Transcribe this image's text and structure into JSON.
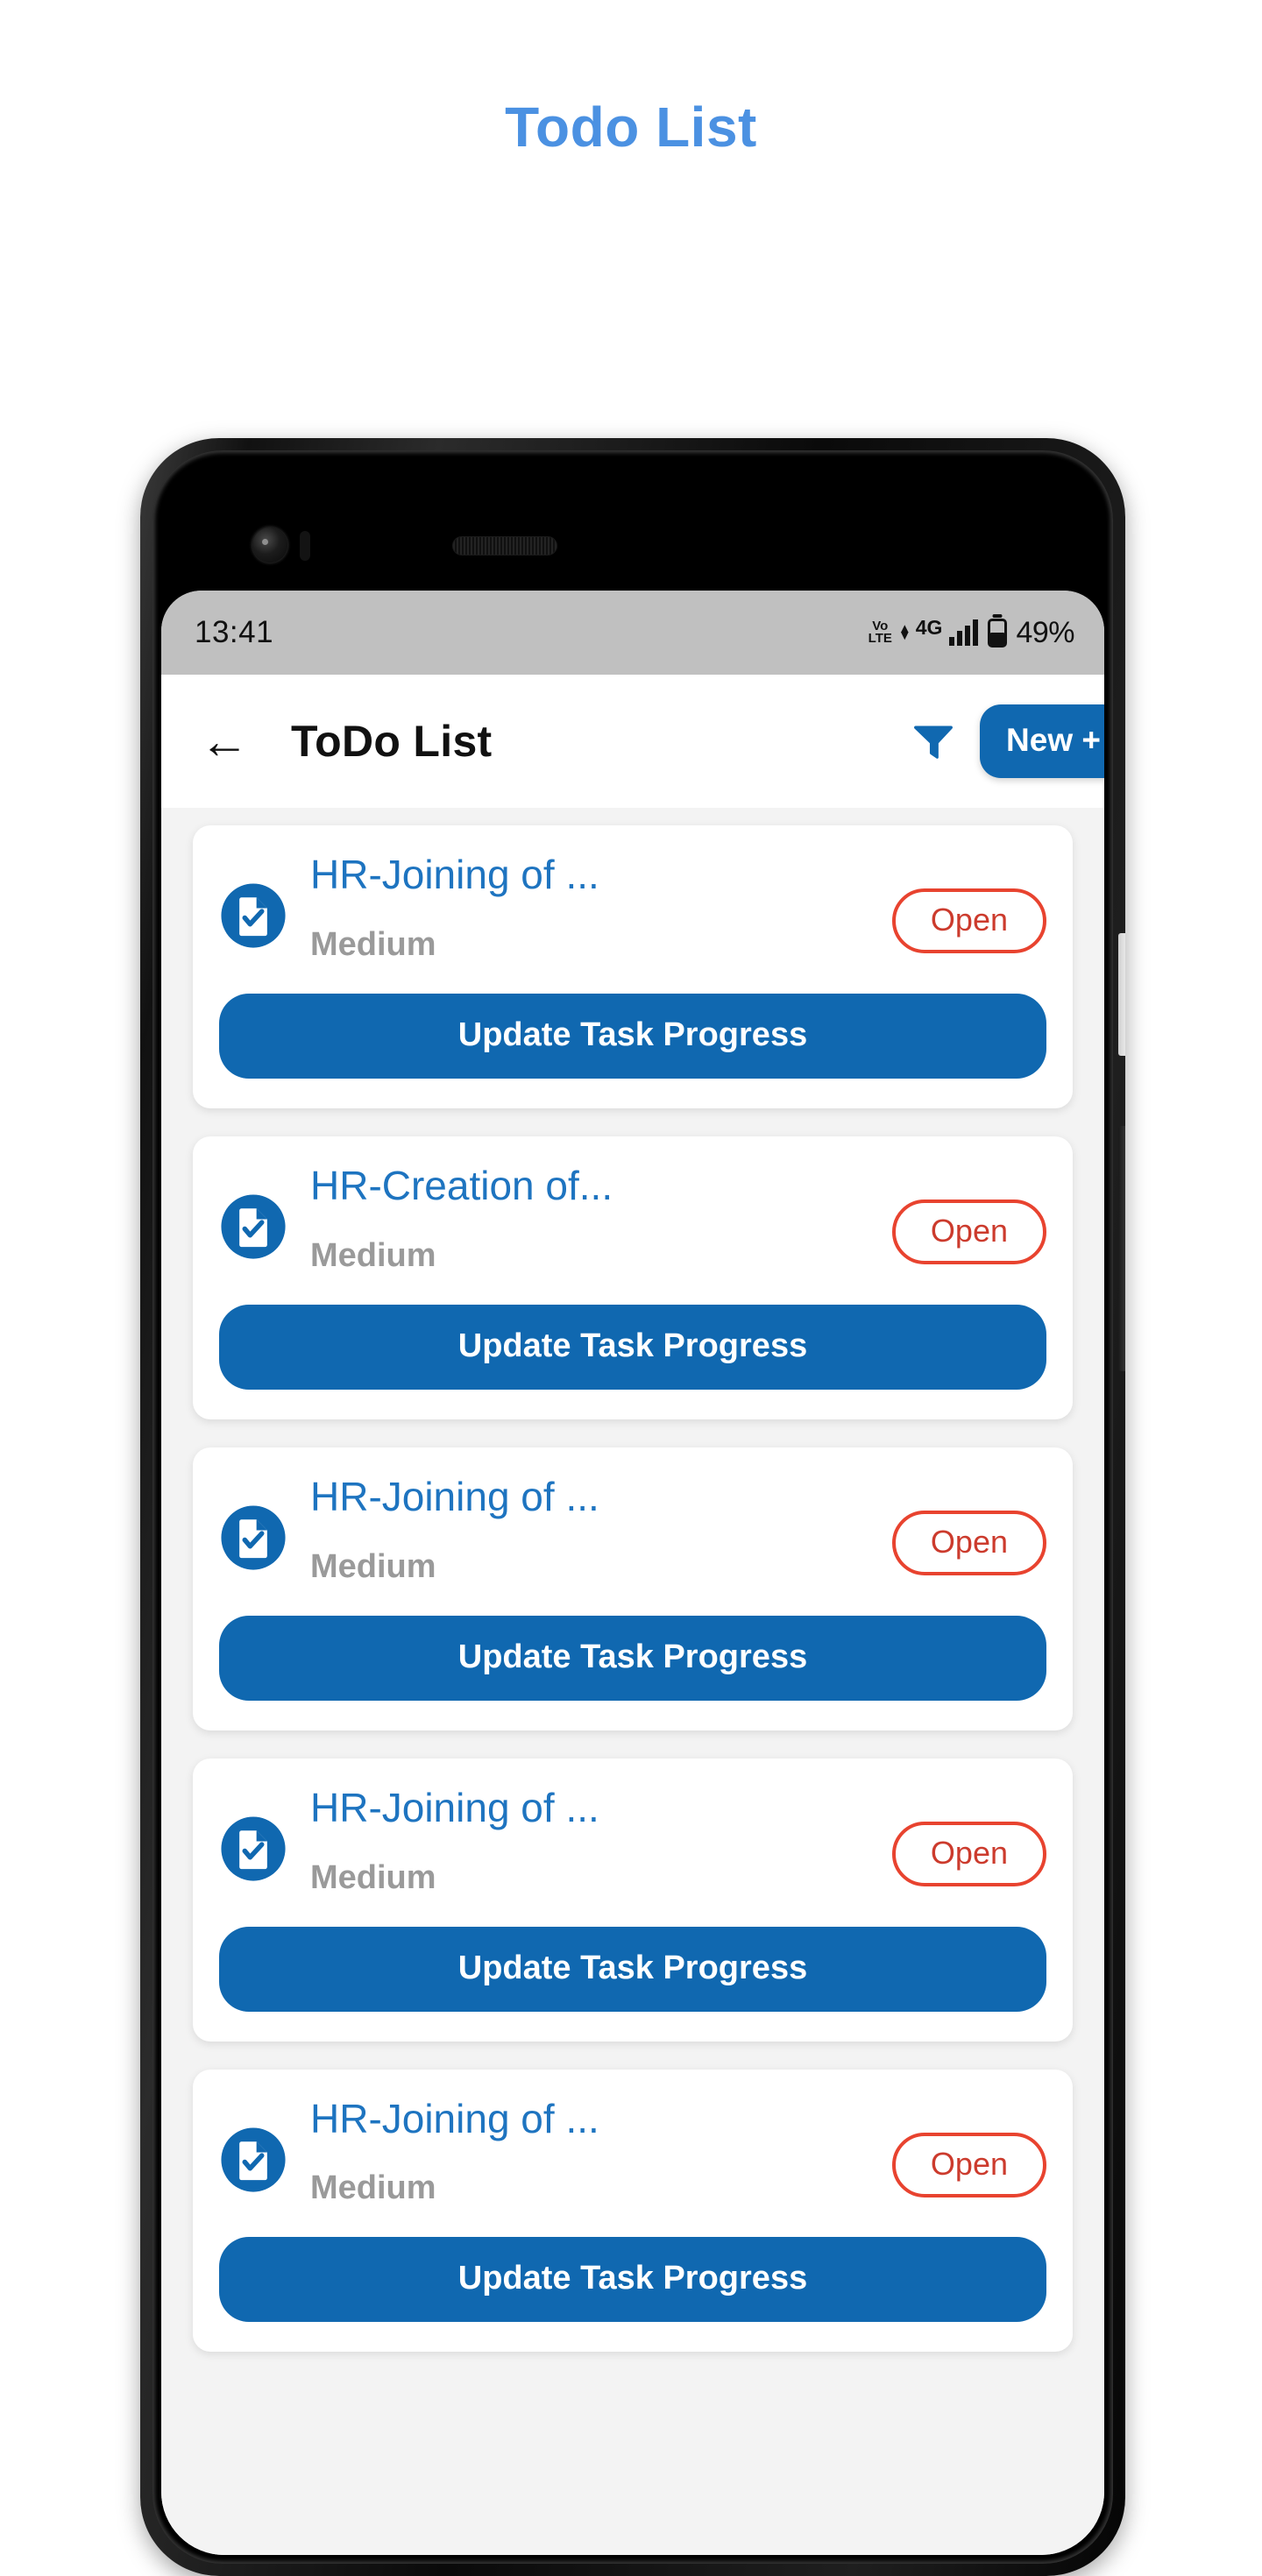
{
  "page": {
    "heading": "Todo List"
  },
  "phone": {
    "status_bar": {
      "time": "13:41",
      "volte_top": "Vo",
      "volte_bottom": "LTE",
      "network": "4G",
      "battery_percent": "49%",
      "signal_bars": 4,
      "battery_level": 49
    },
    "app_bar": {
      "back_icon": "arrow-left-icon",
      "title": "ToDo List",
      "filter_icon": "filter-funnel-icon",
      "new_button_label": "New +"
    }
  },
  "tasks": [
    {
      "icon": "document-check-icon",
      "title": "HR-Joining of ...",
      "priority": "Medium",
      "status": "Open",
      "action_label": "Update Task Progress"
    },
    {
      "icon": "document-check-icon",
      "title": "HR-Creation of...",
      "priority": "Medium",
      "status": "Open",
      "action_label": "Update Task Progress"
    },
    {
      "icon": "document-check-icon",
      "title": "HR-Joining of ...",
      "priority": "Medium",
      "status": "Open",
      "action_label": "Update Task Progress"
    },
    {
      "icon": "document-check-icon",
      "title": "HR-Joining of ...",
      "priority": "Medium",
      "status": "Open",
      "action_label": "Update Task Progress"
    },
    {
      "icon": "document-check-icon",
      "title": "HR-Joining of ...",
      "priority": "Medium",
      "status": "Open",
      "action_label": "Update Task Progress"
    }
  ],
  "colors": {
    "heading_blue": "#4b91e2",
    "primary_blue": "#1068b0",
    "title_blue": "#1e74c0",
    "status_red": "#e8432f",
    "priority_gray": "#9a9a9a",
    "status_bar_gray": "#c0c0c0",
    "list_background": "#f3f3f3"
  }
}
